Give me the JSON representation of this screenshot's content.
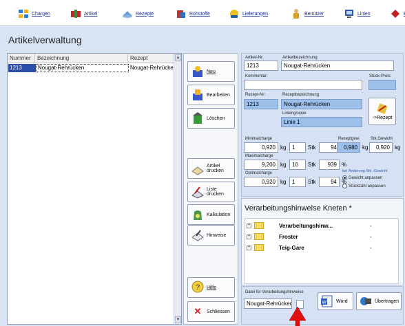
{
  "toolbar": {
    "items": [
      {
        "label": "Chargen"
      },
      {
        "label": "Artikel"
      },
      {
        "label": "Rezepte"
      },
      {
        "label": "Rohstoffe"
      },
      {
        "label": "Lieferungen"
      },
      {
        "label": "Benutzer"
      },
      {
        "label": "Linien"
      },
      {
        "label": "Et"
      }
    ]
  },
  "page": {
    "title": "Artikelverwaltung"
  },
  "list": {
    "columns": [
      "Nummer",
      "Bezeichnung",
      "Rezept"
    ],
    "rows": [
      {
        "nummer": "1213",
        "bezeichnung": "Nougat-Rehrücken",
        "rezept": "Nougat-Rehrücken"
      }
    ]
  },
  "buttons": {
    "neu": "Neu",
    "bearbeiten": "Bearbeiten",
    "loeschen": "Löschen",
    "artikel_drucken": "Artikel drucken",
    "liste_drucken": "Liste drucken",
    "kalkulation": "Kalkulation",
    "hinweise": "Hinweise",
    "hilfe": "Hilfe",
    "schliessen": "Schliessen"
  },
  "detail": {
    "artikel_nr_label": "Artikel-Nr:",
    "artikel_nr": "1213",
    "artikelbezeichnung_label": "Artikelbezeichnung",
    "artikelbezeichnung": "Nougat-Rehrücken",
    "kommentar_label": "Kommentar:",
    "kommentar": "",
    "stueck_preis_label": "Stück-Preis:",
    "stueck_preis": "",
    "rezept_nr_label": "Rezept-Nr:",
    "rezept_nr": "1213",
    "rezeptbezeichnung_label": "Rezeptbezeichnung",
    "rezeptbezeichnung": "Nougat-Rehrücken",
    "liniengruppe_label": "Liniengruppe",
    "liniengruppe": "Linie 1",
    "rezept_button": "->Rezept",
    "minimalcharge_label": "Minimalcharge",
    "min_kg": "0,920",
    "min_stk": "1",
    "min_pct": "94",
    "maximalcharge_label": "Maximalcharge",
    "max_kg": "9,200",
    "max_stk": "10",
    "max_pct": "939",
    "optimalcharge_label": "Optimalcharge",
    "opt_kg": "0,920",
    "opt_stk": "1",
    "opt_pct": "94",
    "rezeptgew_label": "Rezeptgew.",
    "rezeptgew": "0,980",
    "stk_gewicht_label": "Stk.Gewicht",
    "stk_gewicht": "0,920",
    "unit_kg": "kg",
    "unit_stk": "Stk",
    "unit_pct": "%",
    "aenderung_label": "bei Änderung Stk.-Gewicht",
    "radio_gewicht": "Gewicht anpassen",
    "radio_stueckzahl": "Stückzahl anpassen"
  },
  "processing": {
    "title": "Verarbeitungshinweise Kneten",
    "title_mark": "*",
    "rows": [
      {
        "name": "Verarbeitungshinw...",
        "value": "-"
      },
      {
        "name": "Froster",
        "value": "-"
      },
      {
        "name": "Teig-Gare",
        "value": "-"
      }
    ]
  },
  "bottom": {
    "datei_label": "Datei für Verarbeitungshinweise",
    "datei_value": "Nougat-Rehrücken",
    "word_button": "Word",
    "uebertragen_button": "Übertragen"
  },
  "colors": {
    "field_blue": "#9dc0ea",
    "panel": "#d6e2f4",
    "pointer_red": "#e01010"
  }
}
